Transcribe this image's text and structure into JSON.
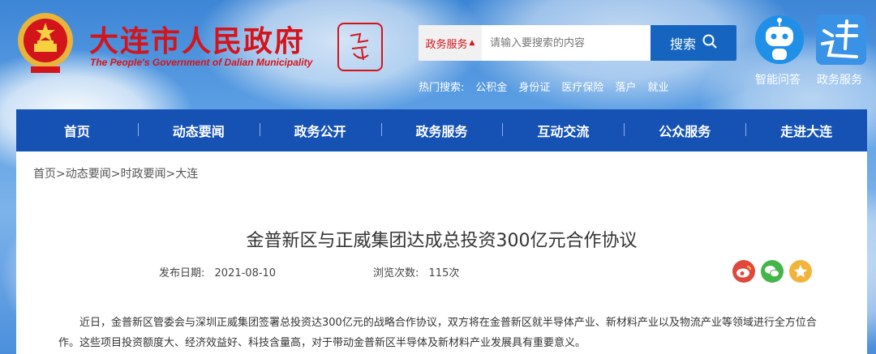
{
  "header": {
    "title_cn": "大连市人民政府",
    "title_en": "The People's Government of Dalian Municipality",
    "seal_text": "中国大连"
  },
  "search": {
    "category": "政务服务",
    "placeholder": "请输入要搜索的内容",
    "button_label": "搜索"
  },
  "hot_search": {
    "label": "热门搜索:",
    "items": [
      "公积金",
      "身份证",
      "医疗保险",
      "落户",
      "就业"
    ]
  },
  "quick_links": [
    {
      "label": "智能问答",
      "icon": "robot-icon"
    },
    {
      "label": "政务服务",
      "icon": "lian-service-icon"
    }
  ],
  "nav": [
    "首页",
    "动态要闻",
    "政务公开",
    "政务服务",
    "互动交流",
    "公众服务",
    "走进大连"
  ],
  "breadcrumb": "首页>动态要闻>时政要闻>大连",
  "article": {
    "title": "金普新区与正威集团达成总投资300亿元合作协议",
    "date_label": "发布日期:",
    "date": "2021-08-10",
    "views_label": "浏览次数:",
    "views": "115次",
    "body": "近日，金普新区管委会与深圳正威集团签署总投资达300亿元的战略合作协议，双方将在金普新区就半导体产业、新材料产业以及物流产业等领域进行全方位合作。这些项目投资额度大、经济效益好、科技含量高，对于带动金普新区半导体及新材料产业发展具有重要意义。"
  },
  "share_icons": [
    "weibo-icon",
    "wechat-icon",
    "favorite-icon"
  ],
  "colors": {
    "brand_red": "#d4141b",
    "nav_blue": "#1552b4",
    "search_blue": "#1565c0"
  }
}
